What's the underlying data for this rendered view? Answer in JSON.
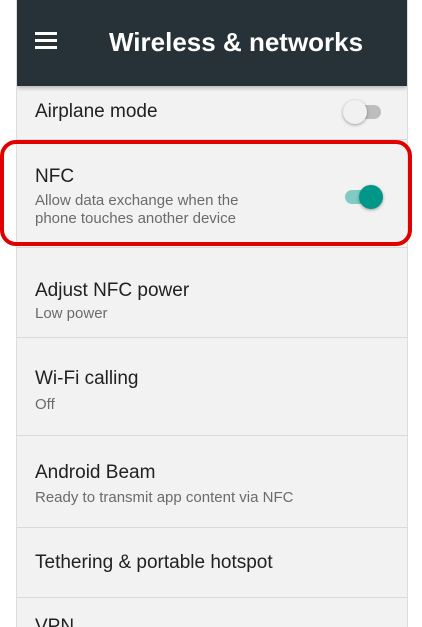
{
  "appbar": {
    "title": "Wireless & networks",
    "menu_icon": "hamburger-menu-icon",
    "background": "#263238"
  },
  "settings": [
    {
      "title": "Airplane mode",
      "summary": "",
      "toggle": "off"
    },
    {
      "title": "NFC",
      "summary_line1": "Allow data exchange when the",
      "summary_line2": "phone touches another device",
      "toggle": "on"
    },
    {
      "title": "Adjust NFC power",
      "summary": "Low power"
    },
    {
      "title": "Wi-Fi calling",
      "summary": "Off"
    },
    {
      "title": "Android Beam",
      "summary": "Ready to transmit app content via NFC"
    },
    {
      "title": "Tethering & portable hotspot",
      "summary": ""
    },
    {
      "title": "VPN",
      "summary": ""
    }
  ],
  "colors": {
    "accent": "#009688",
    "accent_track": "#80cbc4",
    "highlight": "#e00000",
    "background": "#f2f2f2"
  }
}
